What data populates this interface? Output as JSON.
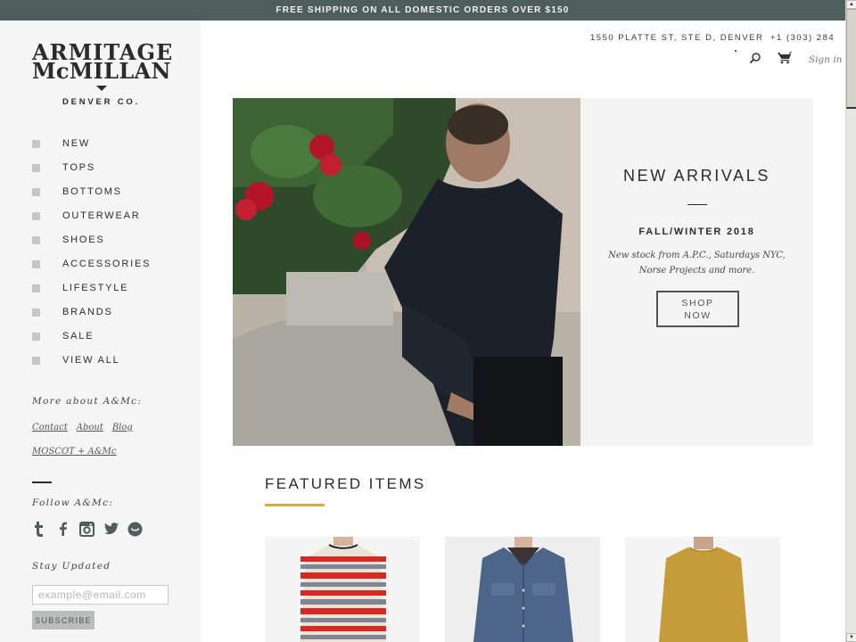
{
  "promo": {
    "text": "FREE SHIPPING ON ALL DOMESTIC ORDERS OVER $150"
  },
  "brand": {
    "line1": "ARMITAGE",
    "line2": "McMILLAN",
    "subtitle": "DENVER CO."
  },
  "nav": {
    "items": [
      {
        "label": "NEW"
      },
      {
        "label": "TOPS"
      },
      {
        "label": "BOTTOMS"
      },
      {
        "label": "OUTERWEAR"
      },
      {
        "label": "SHOES"
      },
      {
        "label": "ACCESSORIES"
      },
      {
        "label": "LIFESTYLE"
      },
      {
        "label": "BRANDS"
      },
      {
        "label": "SALE"
      },
      {
        "label": "VIEW ALL"
      }
    ]
  },
  "sidebar": {
    "more_heading": "More about A&Mc:",
    "links": [
      {
        "label": "Contact"
      },
      {
        "label": "About"
      },
      {
        "label": "Blog"
      }
    ],
    "moscot_link": "MOSCOT + A&Mc",
    "follow_heading": "Follow A&Mc:",
    "social": [
      {
        "icon": "tumblr-icon"
      },
      {
        "icon": "facebook-icon"
      },
      {
        "icon": "instagram-icon"
      },
      {
        "icon": "twitter-icon"
      },
      {
        "icon": "foursquare-icon"
      }
    ],
    "stay_heading": "Stay Updated",
    "email_placeholder": "example@email.com",
    "email_value": "",
    "subscribe_label": "SUBSCRIBE"
  },
  "header": {
    "address": "1550 PLATTE ST, STE D, DENVER",
    "phone": "+1 (303) 284",
    "signin_label": "Sign in",
    "icons": [
      "search-icon",
      "cart-icon"
    ]
  },
  "hero": {
    "title": "NEW ARRIVALS",
    "season": "FALL/WINTER 2018",
    "description": "New stock from A.P.C., Saturdays NYC, Norse Projects and more.",
    "cta_line1": "SHOP",
    "cta_line2": "NOW"
  },
  "featured": {
    "title": "FEATURED ITEMS",
    "accent_color": "#e0a93b",
    "products": [
      {
        "image": "red-striped-sweater"
      },
      {
        "image": "denim-jacket"
      },
      {
        "image": "mustard-sweater"
      }
    ]
  },
  "colors": {
    "promo_bg": "#4f5d5b",
    "sidebar_bg": "#f4f5f4",
    "accent": "#e0a93b"
  }
}
